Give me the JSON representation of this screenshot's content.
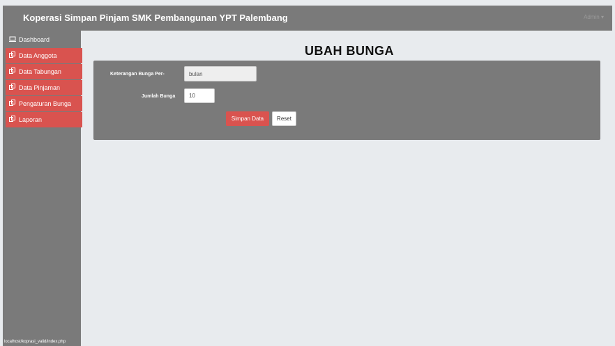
{
  "navbar": {
    "brand": "Koperasi Simpan Pinjam SMK Pembangunan YPT Palembang",
    "user_label": "Admin ▾"
  },
  "sidebar": {
    "items": [
      {
        "label": "Dashboard",
        "icon": "monitor-icon",
        "active": false
      },
      {
        "label": "Data Anggota",
        "icon": "copy-icon",
        "active": true
      },
      {
        "label": "Data Tabungan",
        "icon": "copy-icon",
        "active": true
      },
      {
        "label": "Data Pinjaman",
        "icon": "copy-icon",
        "active": true
      },
      {
        "label": "Pengaturan Bunga",
        "icon": "copy-icon",
        "active": true
      },
      {
        "label": "Laporan",
        "icon": "copy-icon",
        "active": true
      }
    ]
  },
  "main": {
    "title": "UBAH BUNGA",
    "form": {
      "keterangan_label": "Keterangan Bunga Per-",
      "keterangan_value": "bulan",
      "jumlah_label": "Jumlah Bunga",
      "jumlah_value": "10",
      "submit_label": "Simpan Data",
      "reset_label": "Reset"
    }
  },
  "status_bar": {
    "url": "localhost/koprasi_valid/index.php"
  },
  "colors": {
    "accent": "#d9534f",
    "bar": "#7a7a7a",
    "background": "#e8ebee"
  }
}
